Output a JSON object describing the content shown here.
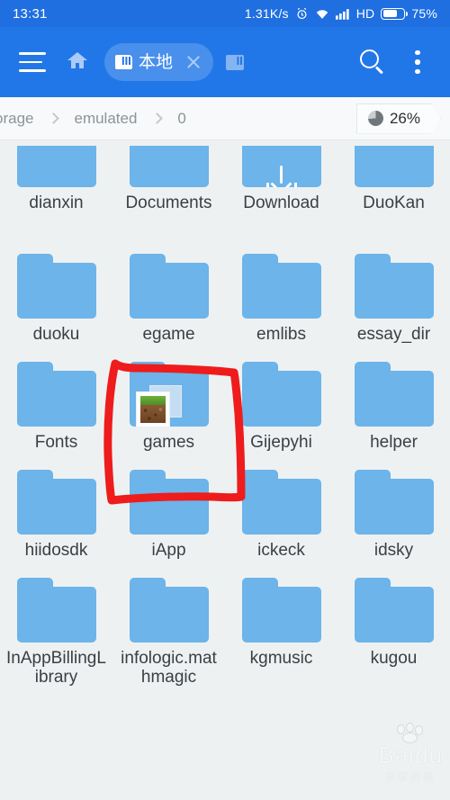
{
  "statusbar": {
    "time": "13:31",
    "network_speed": "1.31K/s",
    "alarm_icon": "alarm-clock-icon",
    "wifi_icon": "wifi-icon",
    "signal_icon": "signal-bars-icon",
    "network_type": "HD",
    "battery_icon": "battery-icon",
    "battery_percent": "75%"
  },
  "toolbar": {
    "menu_icon": "hamburger-menu-icon",
    "home_icon": "home-icon",
    "tab": {
      "storage_icon": "sdcard-icon",
      "label": "本地",
      "close_icon": "close-icon"
    },
    "second_tab_icon": "sdcard-tab-icon",
    "search_icon": "search-icon",
    "overflow_icon": "more-vertical-icon"
  },
  "breadcrumb": {
    "items": [
      "orage",
      "emulated",
      "0"
    ],
    "separator_icon": "chevron-right-icon",
    "usage": {
      "icon": "pie-chart-icon",
      "value": "26%"
    }
  },
  "grid": {
    "rows": [
      [
        {
          "name": "dianxin",
          "icon": "folder-icon",
          "clipped": true
        },
        {
          "name": "Documents",
          "icon": "folder-icon",
          "clipped": true
        },
        {
          "name": "Download",
          "icon": "folder-download-icon",
          "clipped": true
        },
        {
          "name": "DuoKan",
          "icon": "folder-icon",
          "clipped": true
        }
      ],
      [
        {
          "name": "duoku",
          "icon": "folder-icon"
        },
        {
          "name": "egame",
          "icon": "folder-icon"
        },
        {
          "name": "emlibs",
          "icon": "folder-icon"
        },
        {
          "name": "essay_dir",
          "icon": "folder-icon"
        }
      ],
      [
        {
          "name": "Fonts",
          "icon": "folder-icon"
        },
        {
          "name": "games",
          "icon": "folder-thumbnail-icon",
          "thumbnail": "minecraft-grass-block",
          "annotated": true
        },
        {
          "name": "Gijepyhi",
          "icon": "folder-icon"
        },
        {
          "name": "helper",
          "icon": "folder-icon"
        }
      ],
      [
        {
          "name": "hiidosdk",
          "icon": "folder-icon"
        },
        {
          "name": "iApp",
          "icon": "folder-icon"
        },
        {
          "name": "ickeck",
          "icon": "folder-icon"
        },
        {
          "name": "idsky",
          "icon": "folder-icon"
        }
      ],
      [
        {
          "name": "InAppBillingLibrary",
          "icon": "folder-icon"
        },
        {
          "name": "infologic.mathmagic",
          "icon": "folder-icon"
        },
        {
          "name": "kgmusic",
          "icon": "folder-icon"
        },
        {
          "name": "kugou",
          "icon": "folder-icon"
        }
      ]
    ]
  },
  "annotation": {
    "type": "hand-drawn-rectangle",
    "color": "#ee1c1c",
    "target": "games"
  },
  "watermark": {
    "brand": "Baidu",
    "sub": "百度经验"
  },
  "colors": {
    "statusbar_bg": "#1f6fe0",
    "toolbar_bg": "#2277e8",
    "page_bg": "#eef1f2",
    "folder": "#6cb4e9",
    "annotation_red": "#ee1c1c",
    "text": "#3a3f44"
  }
}
